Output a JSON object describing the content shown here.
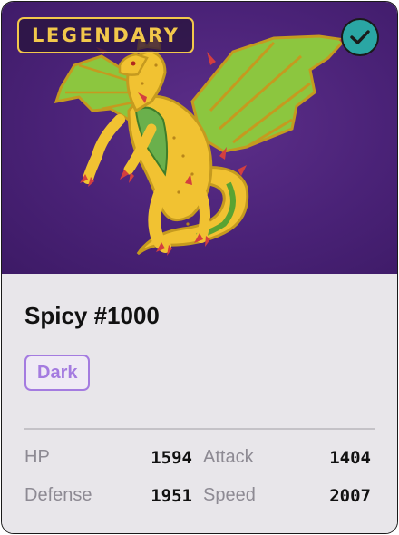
{
  "card": {
    "badge": "LEGENDARY",
    "verified_icon": "check-circle-icon",
    "image_subject": "yellow-green-dragon",
    "name": "Spicy #1000",
    "type": "Dark",
    "stats": [
      {
        "label": "HP",
        "value": "1594"
      },
      {
        "label": "Attack",
        "value": "1404"
      },
      {
        "label": "Defense",
        "value": "1951"
      },
      {
        "label": "Speed",
        "value": "2007"
      }
    ]
  },
  "colors": {
    "badge_gold": "#f2c84b",
    "hero_purple": "#4a2277",
    "verified_teal": "#2aa6a4",
    "type_purple": "#a47be0",
    "panel_bg": "#e8e6ea"
  }
}
